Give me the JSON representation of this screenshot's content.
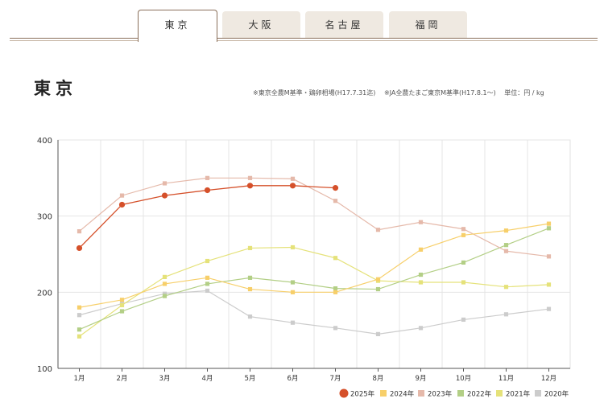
{
  "tabs": [
    {
      "label": "東京",
      "active": true
    },
    {
      "label": "大阪",
      "active": false
    },
    {
      "label": "名古屋",
      "active": false
    },
    {
      "label": "福岡",
      "active": false
    }
  ],
  "page_title": "東京",
  "notes": {
    "note1": "※東京全農M基準・鶏卵相場(H17.7.31迄)",
    "note2": "※JA全農たまご東京M基準(H17.8.1〜)",
    "unit": "単位：円 / kg"
  },
  "chart_data": {
    "type": "line",
    "categories": [
      "1月",
      "2月",
      "3月",
      "4月",
      "5月",
      "6月",
      "7月",
      "8月",
      "9月",
      "10月",
      "11月",
      "12月"
    ],
    "ylim": [
      100,
      400
    ],
    "yticks": [
      100,
      200,
      300,
      400
    ],
    "grid": true,
    "legend": "bottom-right",
    "series": [
      {
        "name": "2020年",
        "color": "#cccccc",
        "marker": "square",
        "values": [
          170,
          185,
          198,
          202,
          168,
          160,
          153,
          145,
          153,
          164,
          171,
          178
        ]
      },
      {
        "name": "2021年",
        "color": "#e5e27a",
        "marker": "square",
        "values": [
          142,
          183,
          220,
          241,
          258,
          259,
          245,
          215,
          213,
          213,
          207,
          210
        ]
      },
      {
        "name": "2022年",
        "color": "#b3cf86",
        "marker": "square",
        "values": [
          151,
          175,
          195,
          211,
          219,
          213,
          205,
          204,
          223,
          239,
          262,
          284
        ]
      },
      {
        "name": "2023年",
        "color": "#e5b9aa",
        "marker": "square",
        "values": [
          280,
          327,
          343,
          350,
          350,
          349,
          320,
          282,
          292,
          283,
          254,
          247
        ]
      },
      {
        "name": "2024年",
        "color": "#f7cf6a",
        "marker": "square",
        "values": [
          180,
          190,
          211,
          219,
          204,
          200,
          200,
          217,
          256,
          275,
          281,
          290
        ]
      },
      {
        "name": "2025年",
        "color": "#d5502a",
        "marker": "circle",
        "values": [
          258,
          315,
          327,
          334,
          340,
          340,
          337,
          null,
          null,
          null,
          null,
          null
        ]
      }
    ],
    "legend_order": [
      "2025年",
      "2024年",
      "2023年",
      "2022年",
      "2021年",
      "2020年"
    ]
  }
}
